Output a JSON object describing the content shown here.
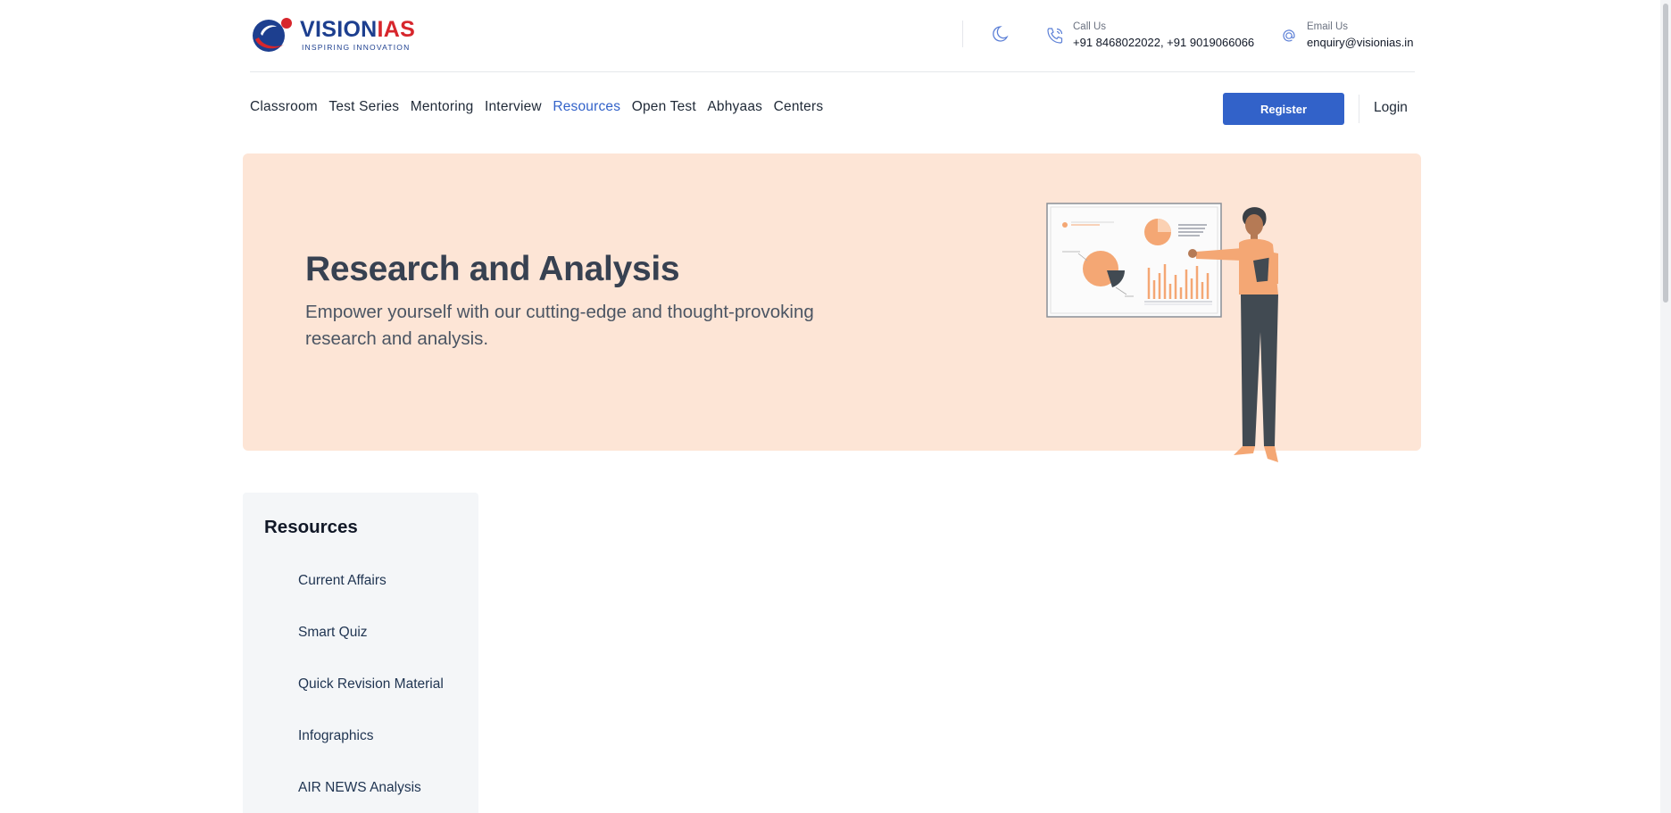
{
  "header": {
    "logo": {
      "title_part1": "VISION",
      "title_part2": "IAS",
      "tagline": "INSPIRING INNOVATION"
    },
    "theme_toggle_icon": "moon-icon",
    "call": {
      "label": "Call Us",
      "value": "+91 8468022022, +91 9019066066",
      "icon": "phone-icon"
    },
    "email": {
      "label": "Email Us",
      "value": "enquiry@visionias.in",
      "icon": "at-icon"
    }
  },
  "nav": {
    "items": [
      {
        "label": "Classroom"
      },
      {
        "label": "Test Series"
      },
      {
        "label": "Mentoring"
      },
      {
        "label": "Interview"
      },
      {
        "label": "Resources",
        "active": true
      },
      {
        "label": "Open Test"
      },
      {
        "label": "Abhyaas"
      },
      {
        "label": "Centers"
      }
    ],
    "register_label": "Register",
    "login_label": "Login"
  },
  "hero": {
    "title": "Research and Analysis",
    "subtitle": "Empower yourself with our cutting-edge and thought-provoking research and analysis."
  },
  "sidebar": {
    "title": "Resources",
    "items": [
      {
        "label": "Current Affairs"
      },
      {
        "label": "Smart Quiz"
      },
      {
        "label": "Quick Revision Material"
      },
      {
        "label": "Infographics"
      },
      {
        "label": "AIR NEWS Analysis"
      }
    ]
  },
  "colors": {
    "brand_blue": "#1d3f8f",
    "brand_red": "#d7262c",
    "accent": "#3262c9",
    "hero_bg": "#fde5d6",
    "sidebar_bg": "#f4f6f8"
  }
}
